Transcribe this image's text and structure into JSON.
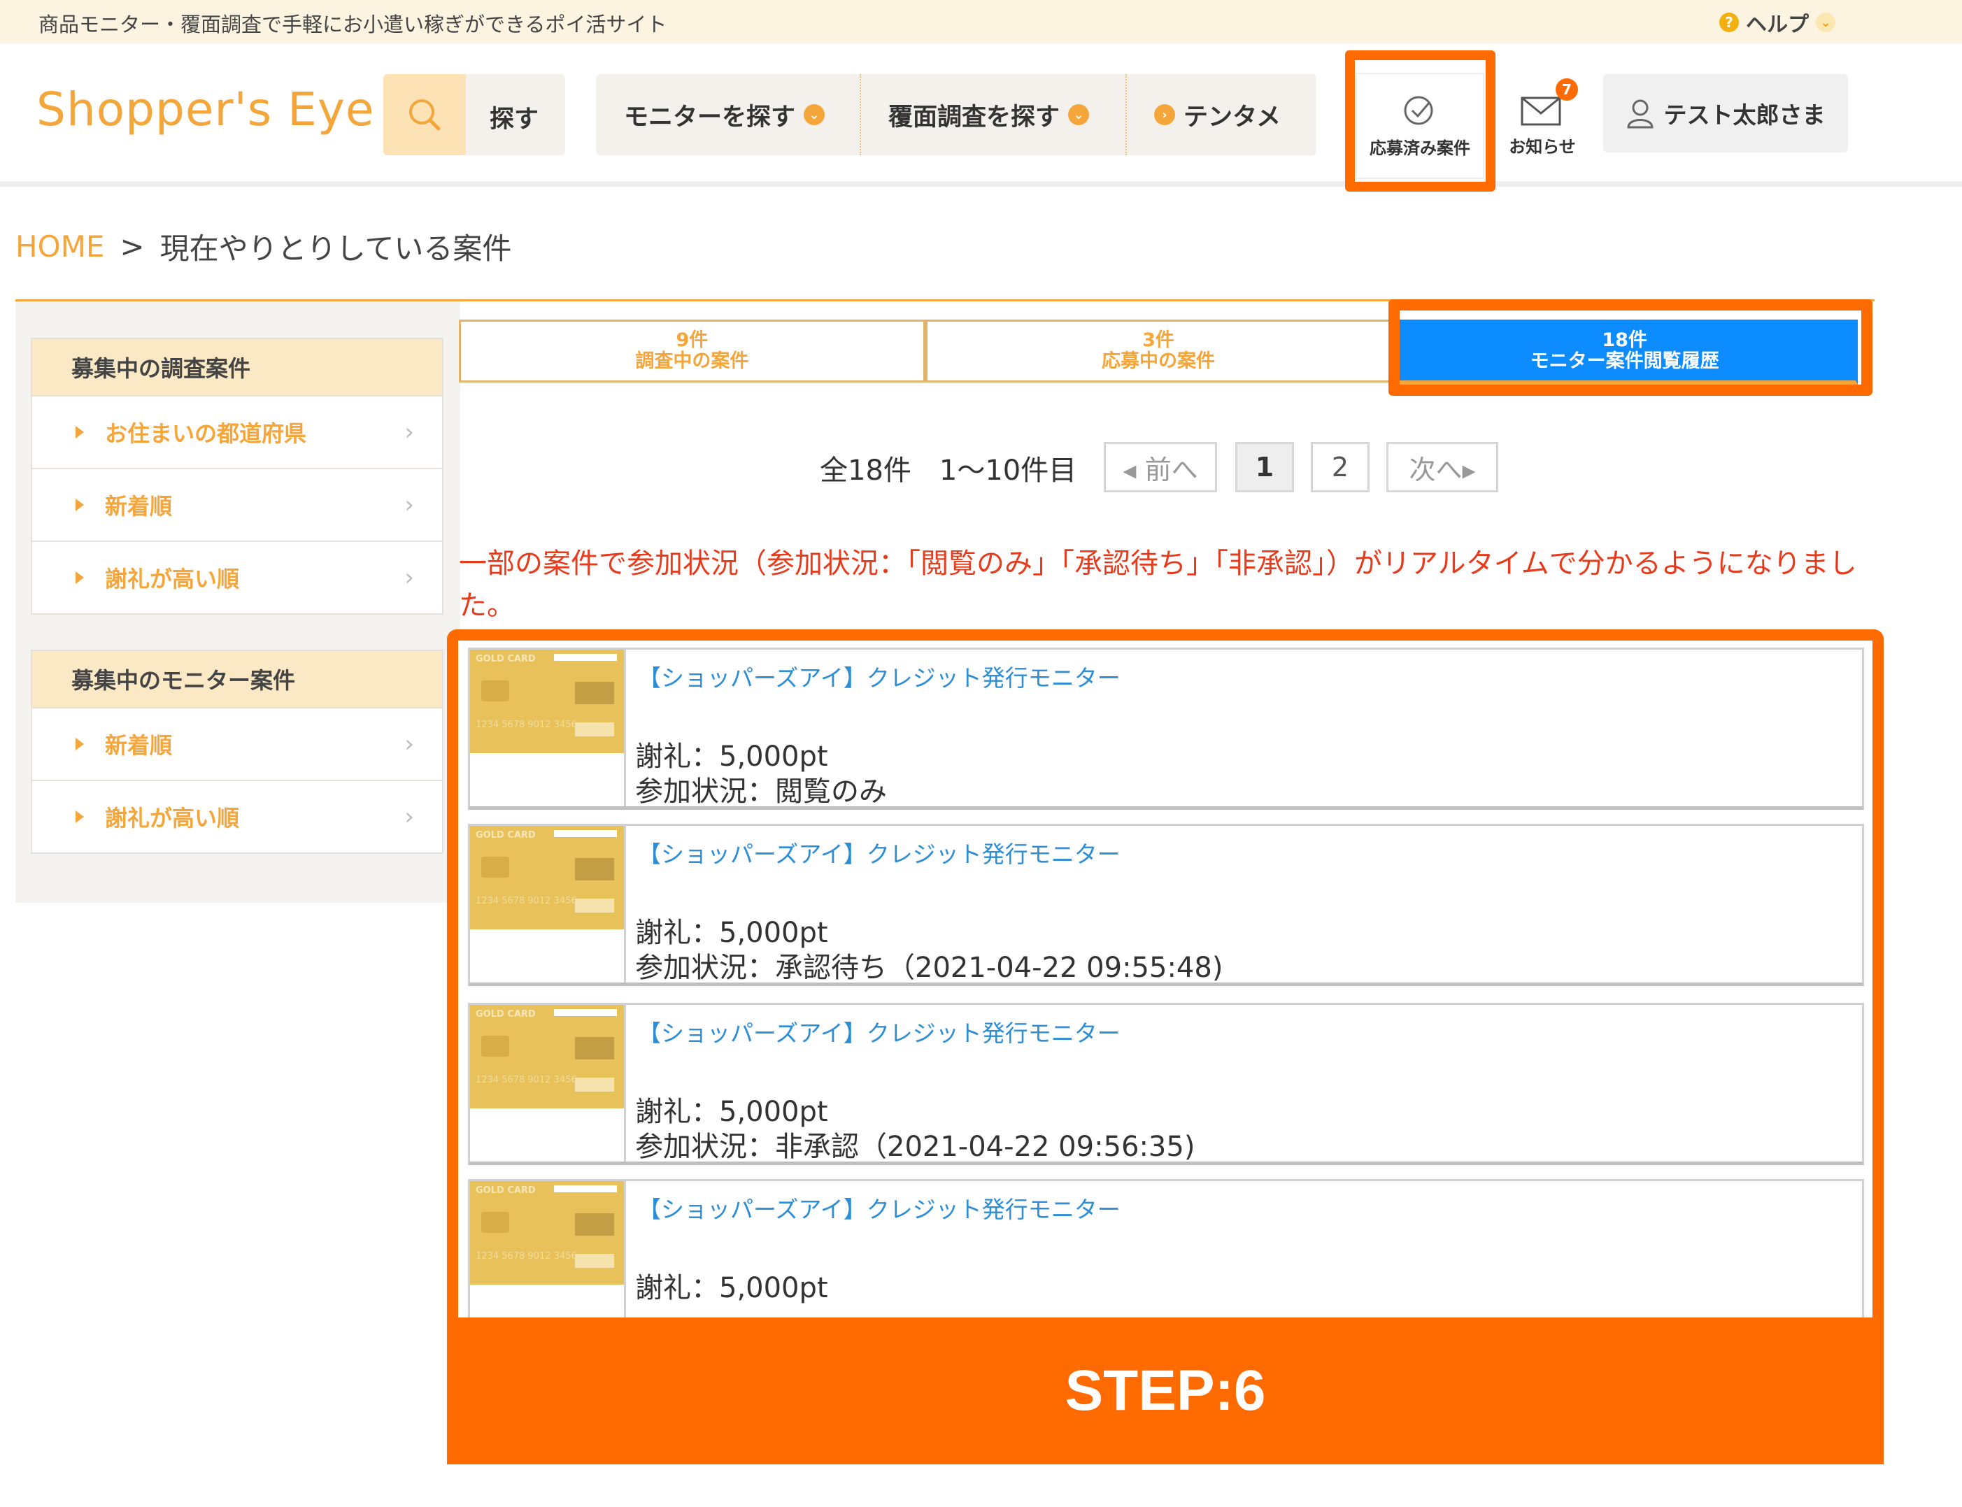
{
  "topbar": {
    "tagline": "商品モニター・覆面調査で手軽にお小遣い稼ぎができるポイ活サイト",
    "help": "ヘルプ"
  },
  "header": {
    "logo": "Shopper's Eye",
    "search_label": "探す",
    "nav": [
      "モニターを探す",
      "覆面調査を探す",
      "テンタメ"
    ],
    "applied_label": "応募済み案件",
    "notice_label": "お知らせ",
    "notice_badge": "7",
    "user_label": "テスト太郎さま"
  },
  "breadcrumb": {
    "home": "HOME",
    "sep": ">",
    "current": "現在やりとりしている案件"
  },
  "sidebar": {
    "survey": {
      "title": "募集中の調査案件",
      "items": [
        "お住まいの都道府県",
        "新着順",
        "謝礼が高い順"
      ]
    },
    "monitor": {
      "title": "募集中のモニター案件",
      "items": [
        "新着順",
        "謝礼が高い順"
      ]
    }
  },
  "tabs": [
    {
      "count": "9件",
      "label": "調査中の案件"
    },
    {
      "count": "3件",
      "label": "応募中の案件"
    },
    {
      "count": "18件",
      "label": "モニター案件閲覧履歴"
    }
  ],
  "pagination": {
    "summary": "全18件　1〜10件目",
    "prev": "◂ 前へ",
    "pages": [
      "1",
      "2"
    ],
    "next": "次へ▸"
  },
  "info_text": "一部の案件で参加状況（参加状況：「閲覧のみ」「承認待ち」「非承認」）がリアルタイムで分かるようになりました。",
  "cards": [
    {
      "title": "【ショッパーズアイ】クレジット発行モニター",
      "reward": "謝礼：5,000pt",
      "status": "参加状況：閲覧のみ"
    },
    {
      "title": "【ショッパーズアイ】クレジット発行モニター",
      "reward": "謝礼：5,000pt",
      "status": "参加状況：承認待ち（2021-04-22 09:55:48)"
    },
    {
      "title": "【ショッパーズアイ】クレジット発行モニター",
      "reward": "謝礼：5,000pt",
      "status": "参加状況：非承認（2021-04-22 09:56:35)"
    },
    {
      "title": "【ショッパーズアイ】クレジット発行モニター",
      "reward": "謝礼：5,000pt",
      "status": ""
    }
  ],
  "card_thumb": {
    "brand": "GOLD CARD",
    "number": "1234 5678 9012 3456"
  },
  "step_label": "STEP:6",
  "colors": {
    "accent": "#f4a63b",
    "highlight": "#ff6b00",
    "tab_active": "#0c8cff",
    "info": "#e63c1e"
  }
}
